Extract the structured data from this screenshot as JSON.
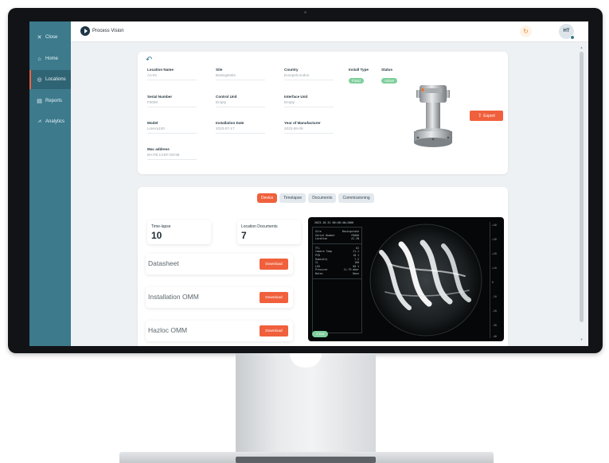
{
  "sidebar": {
    "items": [
      {
        "icon": "close-icon",
        "glyph": "✕",
        "label": "Close"
      },
      {
        "icon": "home-icon",
        "glyph": "⌂",
        "label": "Home"
      },
      {
        "icon": "location-icon",
        "glyph": "◎",
        "label": "Locations"
      },
      {
        "icon": "reports-icon",
        "glyph": "▤",
        "label": "Reports"
      },
      {
        "icon": "analytics-icon",
        "glyph": "⩘",
        "label": "Analytics"
      }
    ],
    "active_index": 2,
    "color": "#3c7a8c"
  },
  "header": {
    "app_name": "Process Vision",
    "sync_glyph": "↻",
    "avatar_initials": "HT"
  },
  "details": {
    "fields": [
      {
        "label": "Location Name",
        "value": "A1-IN"
      },
      {
        "label": "Site",
        "value": "Basingstoke"
      },
      {
        "label": "Country",
        "value": "Europe/London"
      },
      {
        "label": "Install Type",
        "badge": "Fixed"
      },
      {
        "label": "Status",
        "badge": "Active"
      },
      {
        "label": "Serial Number",
        "value": "F0000"
      },
      {
        "label": "Control Unit",
        "value": "Empty"
      },
      {
        "label": "Interface Unit",
        "value": "Empty"
      },
      {
        "label": "Model",
        "value": "LineVu100"
      },
      {
        "label": "Installation Date",
        "value": "2023-07-17"
      },
      {
        "label": "Year of Manufacturer",
        "value": "2023-06-09"
      },
      {
        "label": "Mac address",
        "value": "BA:FB:13:EF:D8:98"
      }
    ],
    "export_label": "Export"
  },
  "tabs": [
    "Device",
    "Timelapse",
    "Documents",
    "Commissioning"
  ],
  "active_tab": 0,
  "stats": {
    "timelapse_label": "Time-lapse",
    "timelapse_count": "10",
    "documents_label": "Location Documents",
    "documents_count": "7"
  },
  "documents": [
    {
      "name": "Datasheet",
      "action": "Download"
    },
    {
      "name": "Installation OMM",
      "action": "Download"
    },
    {
      "name": "Hazloc OMM",
      "action": "Download"
    }
  ],
  "camera": {
    "timestamp": "2023-10-31 00:48:46+1000",
    "meta": [
      {
        "key": "Site",
        "val": "Basingstoke"
      },
      {
        "key": "Serial Number",
        "val": "F0000"
      },
      {
        "key": "Location",
        "val": "A1-IN"
      }
    ],
    "readings": [
      {
        "key": "TTL",
        "val": "62"
      },
      {
        "key": "Camera Temp",
        "val": "21.1"
      },
      {
        "key": "PCB",
        "val": "18.1"
      },
      {
        "key": "Humidity",
        "val": "7.2"
      },
      {
        "key": "IL",
        "val": "100"
      },
      {
        "key": "LED",
        "val": "80 %"
      },
      {
        "key": "Pressure",
        "val": "11.79 mbar"
      },
      {
        "key": "Notes",
        "val": "None"
      }
    ],
    "exit_label": "Exit",
    "scale_ticks": [
      "+40",
      "+30",
      "+20",
      "+10",
      "0",
      "-10",
      "-20",
      "-30",
      "-40"
    ]
  },
  "colors": {
    "accent": "#f0603c",
    "badge_green": "#7fcf9c",
    "sidebar": "#3c7a8c"
  }
}
